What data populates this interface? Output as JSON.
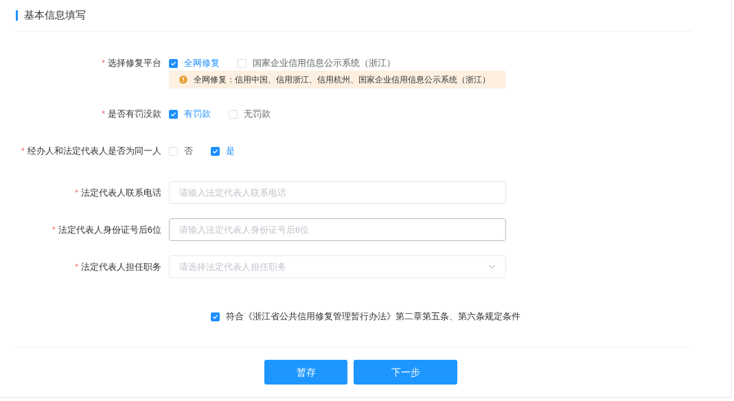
{
  "section_title": "基本信息填写",
  "fields": [
    {
      "kind": "checkbox_group",
      "required_mark": "*",
      "label": "选择修复平台",
      "options": [
        {
          "label": "全网修复",
          "checked": true
        },
        {
          "label": "国家企业信用信息公示系统（浙江）",
          "checked": false
        }
      ],
      "notice": "全网修复：信用中国、信用浙江、信用杭州、国家企业信用信息公示系统（浙江）"
    },
    {
      "kind": "checkbox_group",
      "required_mark": "*",
      "label": "是否有罚没款",
      "options": [
        {
          "label": "有罚款",
          "checked": true
        },
        {
          "label": "无罚款",
          "checked": false
        }
      ]
    },
    {
      "kind": "checkbox_group",
      "required_mark": "*",
      "label": "经办人和法定代表人是否为同一人",
      "options": [
        {
          "label": "否",
          "checked": false
        },
        {
          "label": "是",
          "checked": true
        }
      ]
    },
    {
      "kind": "text",
      "required_mark": "*",
      "label": "法定代表人联系电话",
      "placeholder": "请输入法定代表人联系电话",
      "focused": false
    },
    {
      "kind": "text",
      "required_mark": "*",
      "label": "法定代表人身份证号后6位",
      "placeholder": "请输入法定代表人身份证号后6位",
      "focused": true
    },
    {
      "kind": "select",
      "required_mark": "*",
      "label": "法定代表人担任职务",
      "placeholder": "请选择法定代表人担任职务",
      "focused": false
    }
  ],
  "agreement": {
    "checked": true,
    "text": "符合《浙江省公共信用修复管理暂行办法》第二章第五条、第六条规定条件"
  },
  "buttons": [
    {
      "label": "暂存"
    },
    {
      "label": "下一步"
    }
  ]
}
